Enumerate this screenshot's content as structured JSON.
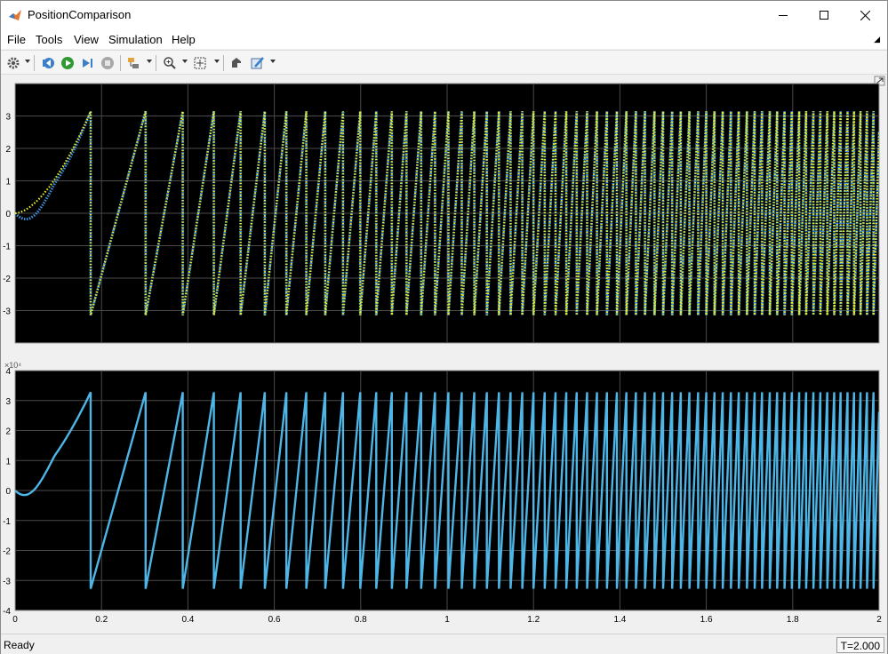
{
  "window": {
    "title": "PositionComparison"
  },
  "menu": [
    "File",
    "Tools",
    "View",
    "Simulation",
    "Help"
  ],
  "toolbar": {
    "icons": [
      "settings-icon",
      "step-back-icon",
      "run-icon",
      "step-forward-icon",
      "stop-icon",
      "highlight-signal-icon",
      "zoom-icon",
      "fit-to-view-icon",
      "restore-view-icon",
      "style-icon"
    ]
  },
  "status": {
    "text": "Ready",
    "time": "T=2.000"
  },
  "colors": {
    "background": "#000000",
    "grid": "#4a4a4a",
    "axis_text": "#ffffff",
    "series_blue": "#4db6e6",
    "series_yellow": "#e8f02a"
  },
  "chart_data": [
    {
      "type": "line",
      "title": "",
      "xlabel": "",
      "ylabel": "",
      "xlim": [
        0,
        2
      ],
      "ylim": [
        -4,
        4
      ],
      "yticks": [
        "-3",
        "-2",
        "-1",
        "0",
        "1",
        "2",
        "3"
      ],
      "grid": true,
      "series": [
        {
          "description": "blue dotted signal",
          "color": "#3a8fd8",
          "style": "dotted"
        },
        {
          "description": "yellow dotted signal",
          "color": "#e8f02a",
          "style": "dotted"
        }
      ],
      "wrap_times": [
        0.175,
        0.302,
        0.388,
        0.46,
        0.522,
        0.578,
        0.628,
        0.674,
        0.718,
        0.759,
        0.799,
        0.836,
        0.872,
        0.906,
        0.94,
        0.972,
        1.003,
        1.034,
        1.063,
        1.092,
        1.12,
        1.147,
        1.174,
        1.2,
        1.226,
        1.251,
        1.276,
        1.3,
        1.324,
        1.347,
        1.37,
        1.393,
        1.415,
        1.437,
        1.458,
        1.48,
        1.5,
        1.521,
        1.541,
        1.561,
        1.581,
        1.6,
        1.619,
        1.638,
        1.657,
        1.675,
        1.694,
        1.712,
        1.729,
        1.747,
        1.764,
        1.781,
        1.798,
        1.815,
        1.831,
        1.848,
        1.864,
        1.88,
        1.896,
        1.911,
        1.927,
        1.942,
        1.957,
        1.972,
        1.987
      ],
      "peak": 3.1416,
      "trough": -3.1416
    },
    {
      "type": "line",
      "title": "",
      "xlabel": "",
      "ylabel": "",
      "xlim": [
        0,
        2
      ],
      "ylim": [
        -4,
        4
      ],
      "y_multiplier": "×10⁴",
      "yticks": [
        "-4",
        "-3",
        "-2",
        "-1",
        "0",
        "1",
        "2",
        "3",
        "4"
      ],
      "xticks": [
        "0",
        "0.2",
        "0.4",
        "0.6",
        "0.8",
        "1",
        "1.2",
        "1.4",
        "1.6",
        "1.8",
        "2"
      ],
      "grid": true,
      "series": [
        {
          "description": "blue solid signal",
          "color": "#4db6e6",
          "style": "solid"
        }
      ],
      "peak": 3.2768,
      "trough": -3.2768
    }
  ]
}
